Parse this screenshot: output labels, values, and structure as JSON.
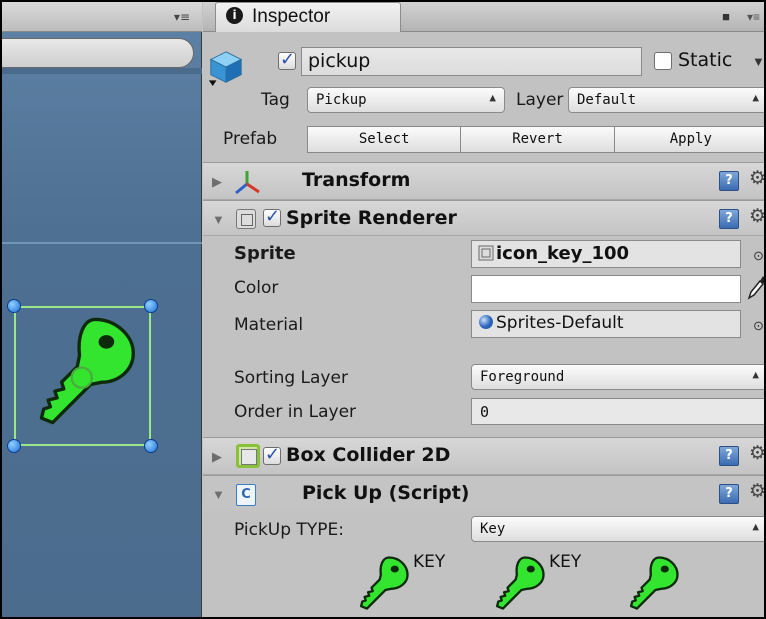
{
  "inspector": {
    "tab_label": "Inspector",
    "tab_icon_glyph": "i",
    "lock_icon": "lock-icon",
    "menu_icon": "tab-menu-icon"
  },
  "game_object": {
    "active": true,
    "name": "pickup",
    "static_label": "Static",
    "static_checked": false,
    "tag_label": "Tag",
    "tag_value": "Pickup",
    "layer_label": "Layer",
    "layer_value": "Default",
    "prefab_label": "Prefab",
    "prefab_buttons": [
      "Select",
      "Revert",
      "Apply"
    ]
  },
  "components": {
    "transform": {
      "title": "Transform",
      "expanded": false
    },
    "sprite_renderer": {
      "title": "Sprite Renderer",
      "enabled": true,
      "expanded": true,
      "sprite_label": "Sprite",
      "sprite_value": "icon_key_100",
      "color_label": "Color",
      "color_value": "#ffffff",
      "material_label": "Material",
      "material_value": "Sprites-Default",
      "sorting_layer_label": "Sorting Layer",
      "sorting_layer_value": "Foreground",
      "order_label": "Order in Layer",
      "order_value": "0"
    },
    "box_collider": {
      "title": "Box Collider 2D",
      "enabled": true,
      "expanded": false
    },
    "pickup_script": {
      "title": "Pick Up (Script)",
      "expanded": true,
      "type_label": "PickUp TYPE:",
      "type_value": "Key",
      "key_labels": [
        "KEY",
        "KEY"
      ]
    }
  },
  "colors": {
    "key_green": "#33e52e",
    "key_outline": "#0d2a0a",
    "scene_blue": "#4d6f91",
    "selection_green": "#9be58a",
    "panel_gray": "#c2c2c2"
  },
  "glyphs": {
    "help": "?",
    "gear": "⚙",
    "fold_closed": "▶",
    "fold_open": "▼",
    "dropdown": "↕",
    "script": "C#"
  }
}
